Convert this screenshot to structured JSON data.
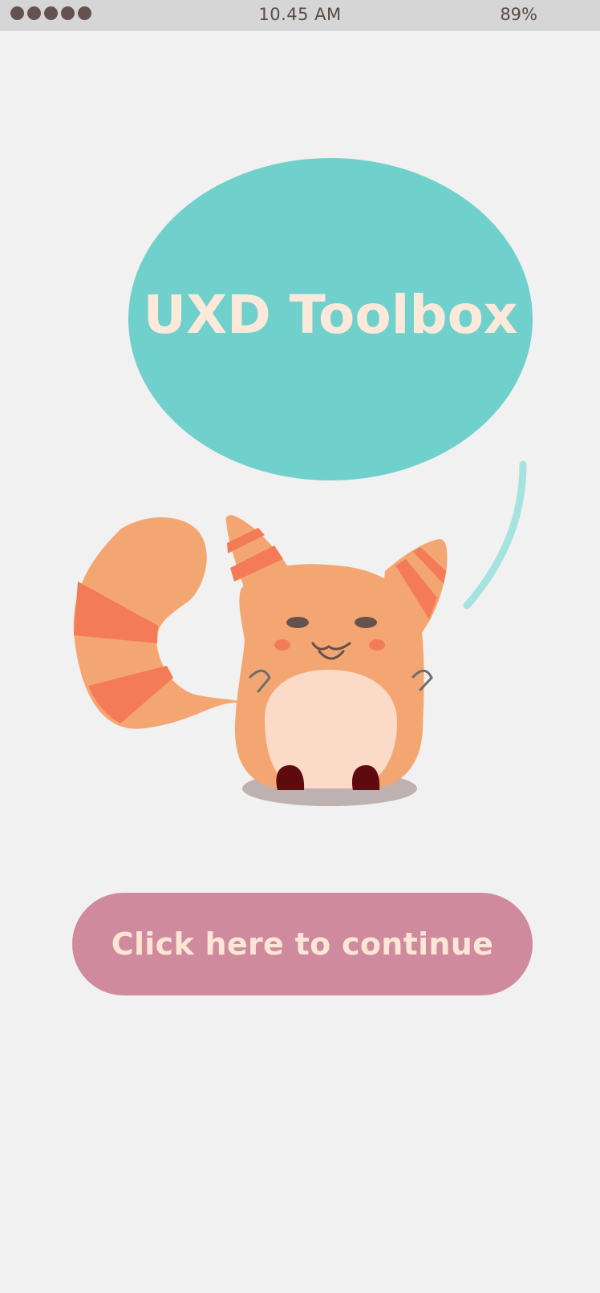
{
  "status_bar": {
    "signal_dots": [
      1,
      2,
      3,
      4,
      5
    ],
    "time": "10.45 AM",
    "battery": "89%"
  },
  "splash": {
    "bubble_color": "#6fd0cc",
    "title": "UXD Toolbox",
    "title_color": "#fde9da",
    "mascot_icon": "striped-cat-mascot-icon"
  },
  "cta": {
    "label": "Click here to continue",
    "color": "#cf8b9d",
    "label_color": "#fde6d6"
  },
  "colors": {
    "background": "#f1f1f1",
    "status_bar": "#d6d6d6",
    "fur": "#f4a672",
    "stripes": "#f37b58",
    "belly": "#fcdac8",
    "feet": "#5e0b0f"
  }
}
